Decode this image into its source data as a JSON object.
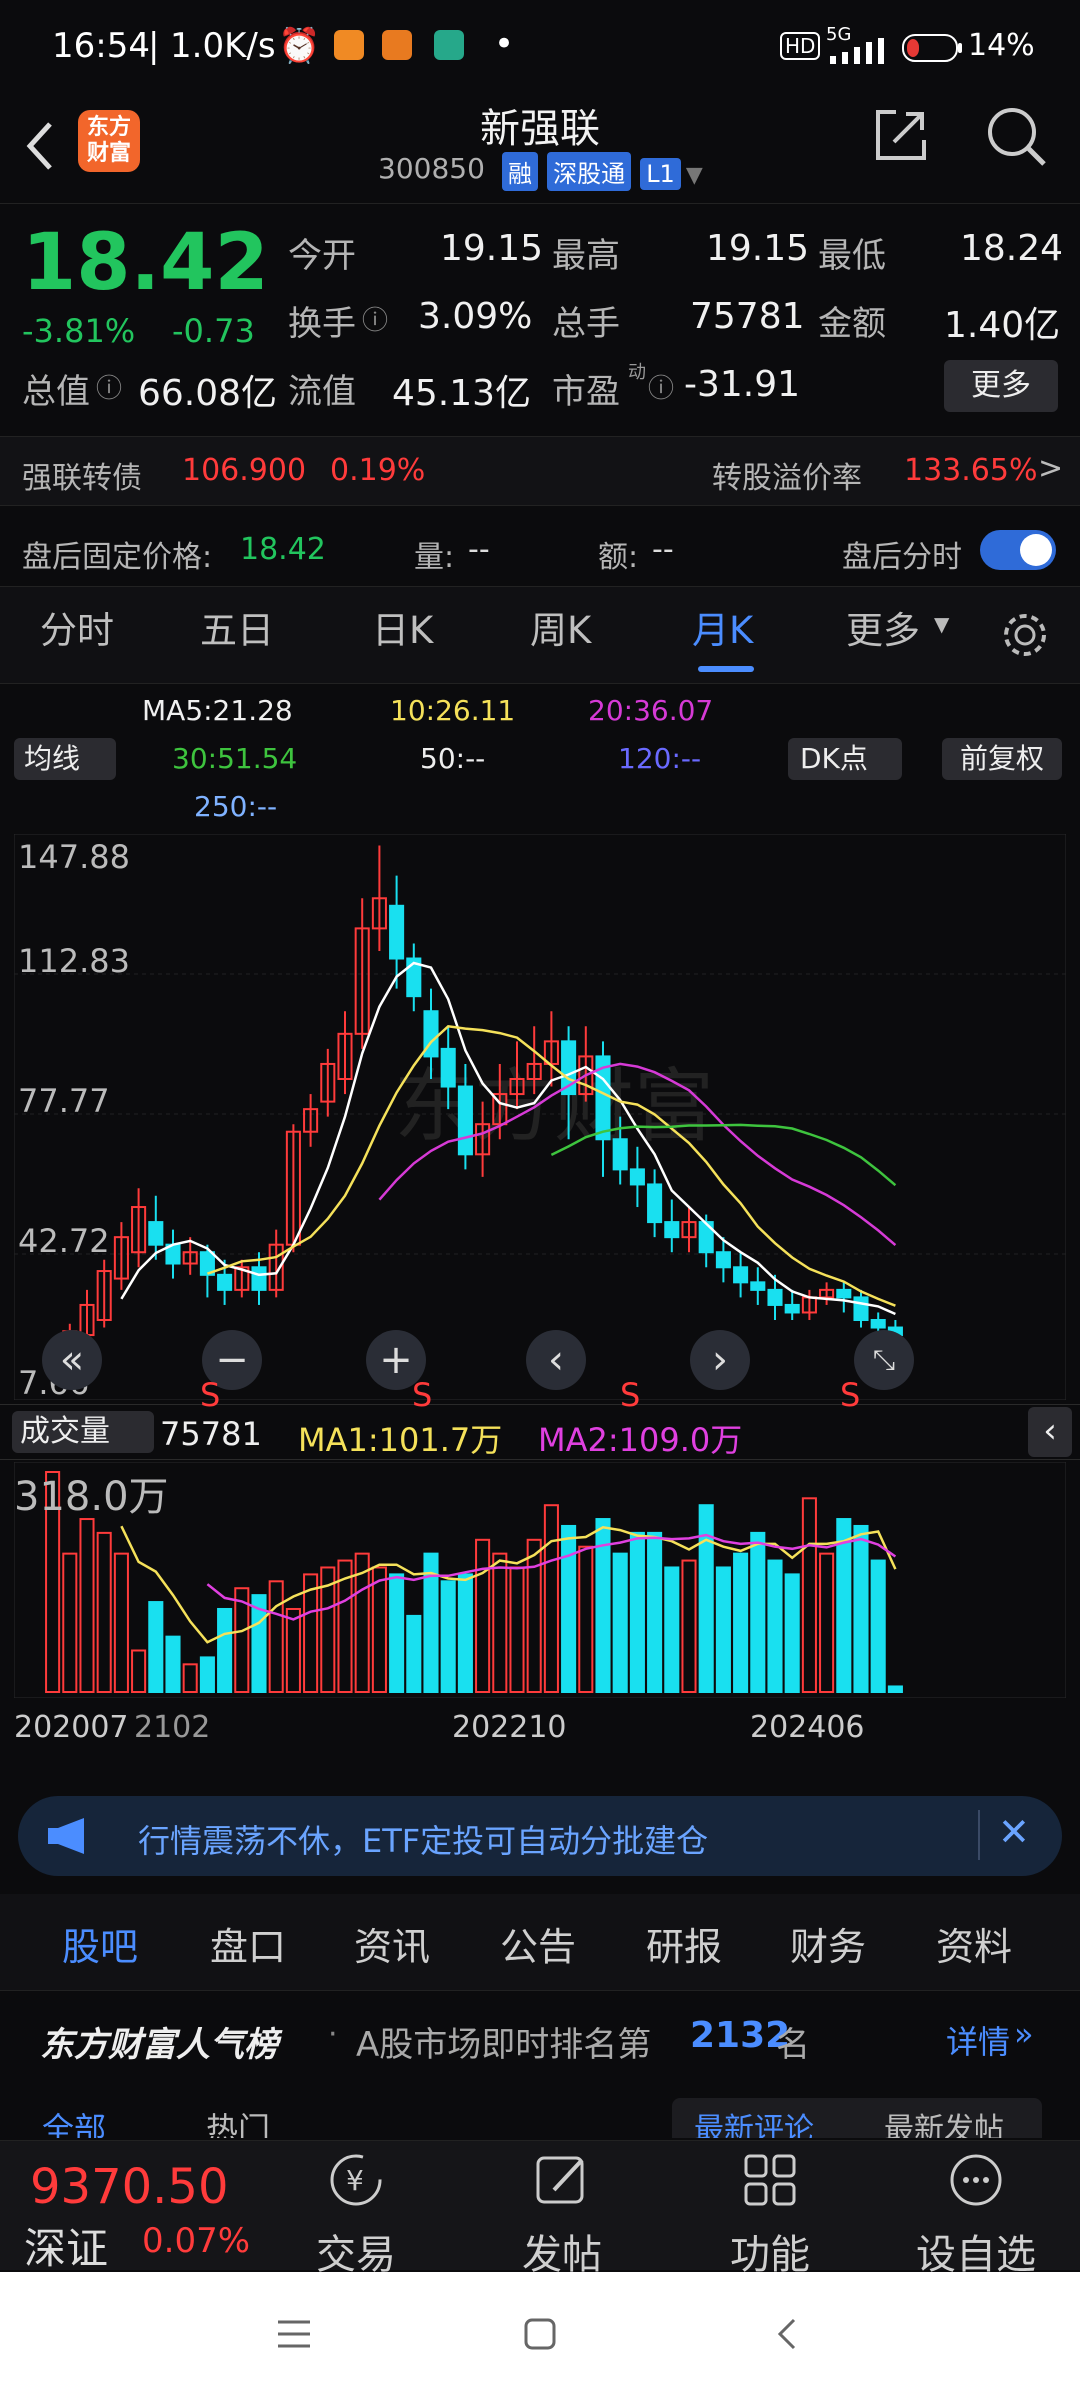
{
  "status": {
    "time": "16:54",
    "speed": "1.0K/s",
    "net": "5G",
    "battery": "14%"
  },
  "header": {
    "app_logo": "东方\n财富",
    "name": "新强联",
    "code": "300850",
    "tags": [
      "融",
      "深股通",
      "L1"
    ]
  },
  "quote": {
    "price": "18.42",
    "pct": "-3.81%",
    "chg": "-0.73",
    "open_lbl": "今开",
    "open": "19.15",
    "high_lbl": "最高",
    "high": "19.15",
    "low_lbl": "最低",
    "low": "18.24",
    "turn_lbl": "换手",
    "turn": "3.09%",
    "vol_lbl": "总手",
    "vol": "75781",
    "amt_lbl": "金额",
    "amt": "1.40亿",
    "mcap_lbl": "总值",
    "mcap": "66.08亿",
    "float_lbl": "流值",
    "float": "45.13亿",
    "pe_lbl": "市盈",
    "pe_sup": "动",
    "pe": "-31.91",
    "more": "更多"
  },
  "bond": {
    "name": "强联转债",
    "price": "106.900",
    "pct": "0.19%",
    "prem_lbl": "转股溢价率",
    "prem": "133.65%"
  },
  "after": {
    "fixed_lbl": "盘后固定价格:",
    "fixed": "18.42",
    "vol_lbl": "量:",
    "vol": "--",
    "amt_lbl": "额:",
    "amt": "--",
    "toggle_lbl": "盘后分时"
  },
  "ktabs": {
    "t1": "分时",
    "t2": "五日",
    "t3": "日K",
    "t4": "周K",
    "t5": "月K",
    "t6": "更多"
  },
  "ma": {
    "ma5": "MA5:21.28",
    "ma10": "10:26.11",
    "ma20": "20:36.07",
    "ma30": "30:51.54",
    "ma50": "50:--",
    "ma120": "120:--",
    "ma250": "250:--",
    "type": "均线",
    "dk": "DK点",
    "fq": "前复权"
  },
  "price_axis": [
    "147.88",
    "112.83",
    "77.77",
    "42.72",
    "7.66"
  ],
  "watermark": "东方财富",
  "vol_legend": {
    "label": "成交量",
    "value": "75781",
    "ma1": "MA1:101.7万",
    "ma2": "MA2:109.0万",
    "max": "318.0万"
  },
  "date_axis": {
    "d1": "202007",
    "d2": "2102",
    "d3": "202210",
    "d4": "202406"
  },
  "banner": "行情震荡不休，ETF定投可自动分批建仓",
  "subtabs": {
    "t1": "股吧",
    "t2": "盘口",
    "t3": "资讯",
    "t4": "公告",
    "t5": "研报",
    "t6": "财务",
    "t7": "资料"
  },
  "popular": {
    "title": "东方财富人气榜",
    "text": "A股市场即时排名第",
    "rank": "2132",
    "suffix": "名",
    "detail": "详情"
  },
  "comments": {
    "all": "全部",
    "hot": "热门",
    "latest_comment": "最新评论",
    "latest_post": "最新发帖"
  },
  "index": {
    "value": "9370.50",
    "name": "深证",
    "pct": "0.07%"
  },
  "nav": {
    "trade": "交易",
    "post": "发帖",
    "func": "功能",
    "watch": "设自选"
  },
  "chart_data": {
    "type": "candlestick",
    "series": [
      {
        "name": "MA5",
        "values": []
      },
      {
        "name": "MA10",
        "values": []
      },
      {
        "name": "MA20",
        "values": []
      },
      {
        "name": "MA30",
        "values": []
      }
    ],
    "ylim": [
      7.66,
      147.88
    ],
    "candles": [
      [
        9,
        14,
        8,
        15
      ],
      [
        13,
        19,
        11,
        21
      ],
      [
        18,
        26,
        16,
        30
      ],
      [
        22,
        35,
        20,
        38
      ],
      [
        33,
        44,
        30,
        48
      ],
      [
        40,
        52,
        36,
        57
      ],
      [
        48,
        42,
        38,
        55
      ],
      [
        42,
        37,
        33,
        46
      ],
      [
        37,
        40,
        34,
        44
      ],
      [
        40,
        34,
        28,
        42
      ],
      [
        34,
        30,
        26,
        38
      ],
      [
        30,
        36,
        28,
        38
      ],
      [
        36,
        30,
        26,
        40
      ],
      [
        30,
        42,
        28,
        46
      ],
      [
        42,
        72,
        40,
        74
      ],
      [
        72,
        78,
        68,
        82
      ],
      [
        80,
        90,
        76,
        94
      ],
      [
        86,
        98,
        82,
        104
      ],
      [
        98,
        126,
        94,
        134
      ],
      [
        126,
        134,
        120,
        148
      ],
      [
        132,
        118,
        110,
        140
      ],
      [
        118,
        108,
        104,
        122
      ],
      [
        104,
        92,
        86,
        110
      ],
      [
        94,
        84,
        78,
        100
      ],
      [
        84,
        66,
        62,
        90
      ],
      [
        66,
        74,
        60,
        80
      ],
      [
        74,
        82,
        70,
        90
      ],
      [
        82,
        86,
        78,
        96
      ],
      [
        86,
        90,
        82,
        100
      ],
      [
        90,
        96,
        84,
        104
      ],
      [
        96,
        82,
        70,
        100
      ],
      [
        82,
        92,
        80,
        100
      ],
      [
        92,
        70,
        60,
        96
      ],
      [
        70,
        62,
        58,
        76
      ],
      [
        62,
        58,
        52,
        68
      ],
      [
        58,
        48,
        44,
        62
      ],
      [
        48,
        44,
        40,
        54
      ],
      [
        44,
        48,
        40,
        52
      ],
      [
        48,
        40,
        36,
        50
      ],
      [
        40,
        36,
        32,
        44
      ],
      [
        36,
        32,
        28,
        40
      ],
      [
        32,
        30,
        26,
        36
      ],
      [
        30,
        26,
        22,
        34
      ],
      [
        26,
        24,
        22,
        30
      ],
      [
        24,
        28,
        22,
        30
      ],
      [
        28,
        30,
        26,
        32
      ],
      [
        30,
        28,
        24,
        32
      ],
      [
        28,
        22,
        20,
        30
      ],
      [
        22,
        20,
        16,
        24
      ],
      [
        20,
        18,
        16,
        22
      ]
    ],
    "volumes": [
      318,
      200,
      250,
      230,
      200,
      60,
      130,
      80,
      40,
      50,
      120,
      150,
      140,
      160,
      120,
      170,
      180,
      190,
      200,
      180,
      170,
      110,
      200,
      160,
      170,
      220,
      200,
      180,
      220,
      270,
      240,
      210,
      250,
      200,
      230,
      230,
      180,
      190,
      270,
      180,
      200,
      230,
      190,
      170,
      280,
      200,
      250,
      240,
      190,
      8
    ]
  }
}
